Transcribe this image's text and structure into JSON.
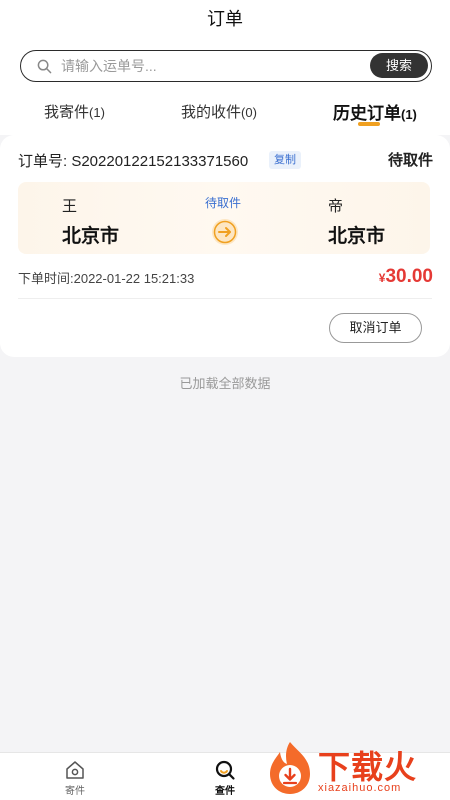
{
  "header": {
    "title": "订单"
  },
  "search": {
    "placeholder": "请输入运单号...",
    "button_label": "搜索"
  },
  "tabs": [
    {
      "label": "我寄件",
      "count": "(1)"
    },
    {
      "label": "我的收件",
      "count": "(0)"
    },
    {
      "label": "历史订单",
      "count": "(1)"
    }
  ],
  "order": {
    "order_no": "订单号: S20220122152133371560",
    "copy_label": "复制",
    "status": "待取件",
    "sender": {
      "name": "王",
      "city": "北京市"
    },
    "mid_status": "待取件",
    "receiver": {
      "name": "帝",
      "city": "北京市"
    },
    "time": "下单时间:2022-01-22 15:21:33",
    "currency": "¥",
    "amount": "30.00",
    "cancel_label": "取消订单"
  },
  "footer_note": "已加载全部数据",
  "bottom_nav": [
    {
      "label": "寄件",
      "icon": "home-icon"
    },
    {
      "label": "查件",
      "icon": "search-icon"
    }
  ],
  "watermark": {
    "text": "下载火",
    "url": "xiazaihuo.com"
  },
  "colors": {
    "accent": "#f0a020",
    "price": "#e53935",
    "link": "#3a6fd0",
    "dark_button": "#333333"
  }
}
